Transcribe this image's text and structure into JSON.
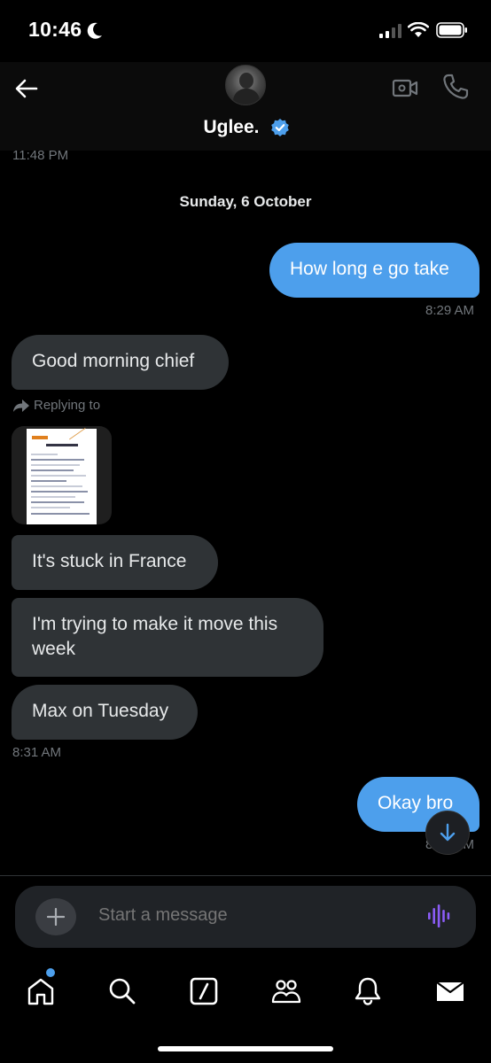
{
  "status_bar": {
    "time": "10:46"
  },
  "header": {
    "contact_name": "Uglee."
  },
  "timeline": {
    "clipped_time": "11:48 PM",
    "date_separator": "Sunday, 6 October",
    "messages": [
      {
        "direction": "outgoing",
        "text": "How long e go take",
        "time": "8:29 AM"
      },
      {
        "direction": "incoming",
        "text": "Good morning chief"
      },
      {
        "direction": "incoming",
        "type": "reply",
        "reply_label": "Replying to"
      },
      {
        "direction": "incoming",
        "text": "It's stuck in France"
      },
      {
        "direction": "incoming",
        "text": "I'm trying to make it move this week"
      },
      {
        "direction": "incoming",
        "text": "Max on Tuesday",
        "time": "8:31 AM"
      },
      {
        "direction": "outgoing",
        "text": "Okay bro",
        "time": "8:35 AM"
      }
    ]
  },
  "composer": {
    "placeholder": "Start a message"
  },
  "bottom_nav": {
    "items": [
      "home-icon",
      "search-icon",
      "grok-icon",
      "communities-icon",
      "notifications-icon",
      "messages-icon"
    ]
  },
  "colors": {
    "accent": "#4d9fec",
    "incoming_bubble": "#2f3336",
    "voice": "#8b5cf6"
  }
}
